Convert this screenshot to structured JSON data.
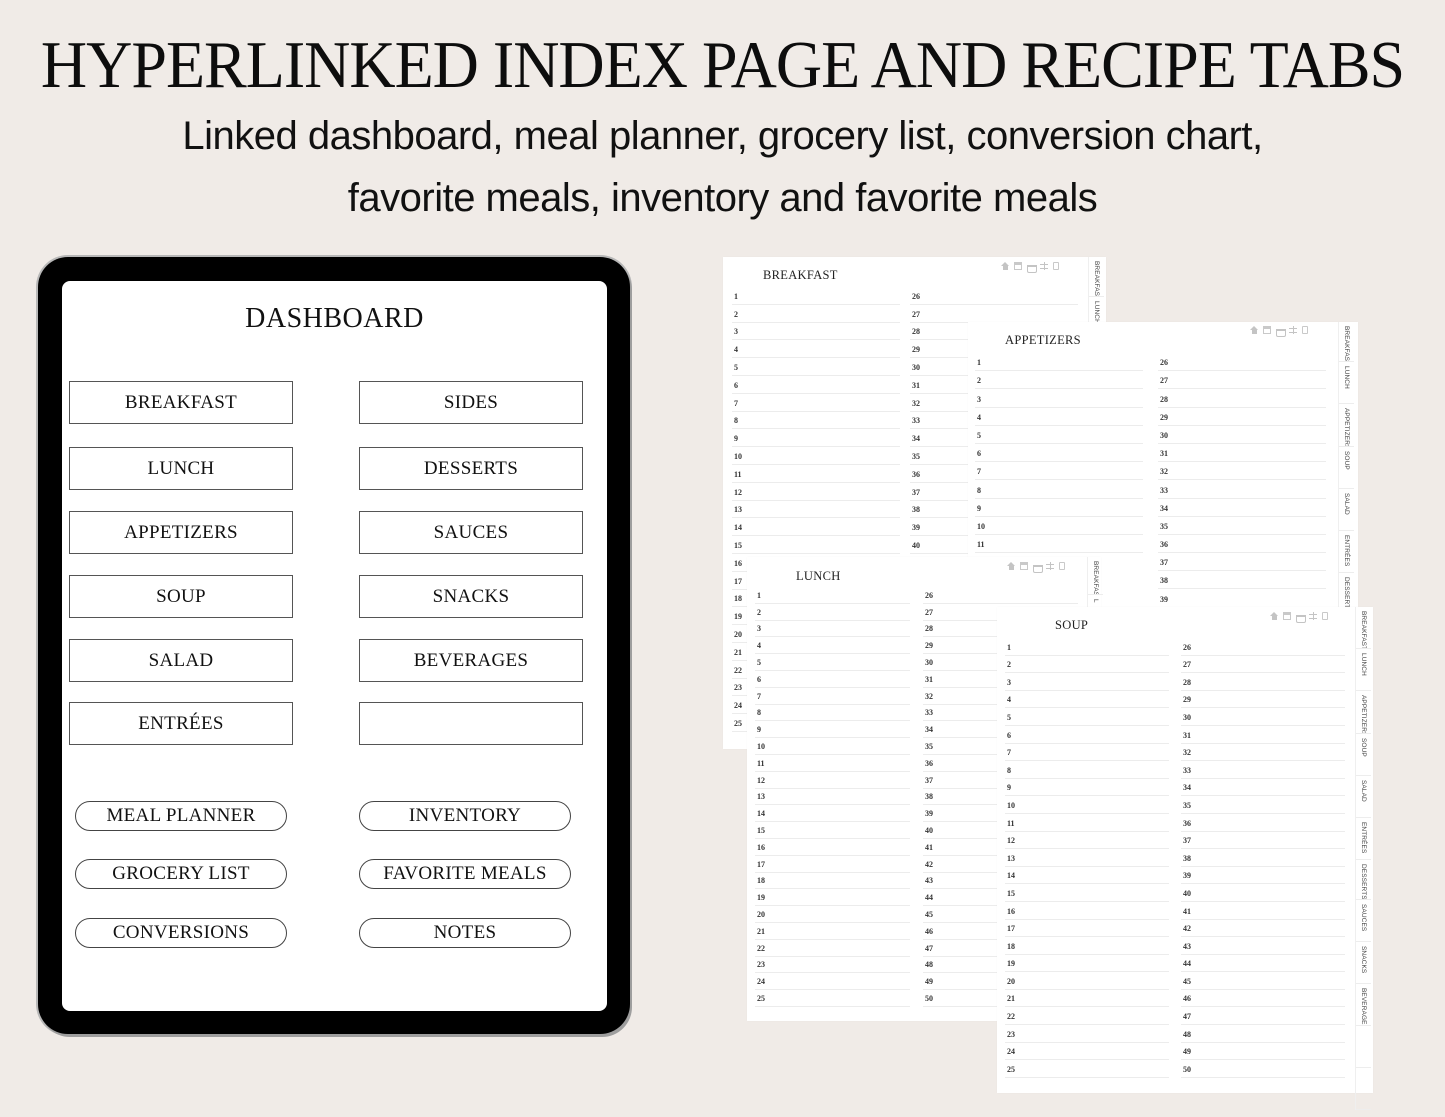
{
  "header": {
    "title": "HYPERLINKED INDEX PAGE AND RECIPE TABS",
    "subtitle_line1": "Linked dashboard, meal planner, grocery list, conversion chart,",
    "subtitle_line2": "favorite meals, inventory and favorite meals"
  },
  "dashboard": {
    "title": "DASHBOARD",
    "category_buttons": [
      {
        "label": "BREAKFAST"
      },
      {
        "label": "SIDES"
      },
      {
        "label": "LUNCH"
      },
      {
        "label": "DESSERTS"
      },
      {
        "label": "APPETIZERS"
      },
      {
        "label": "SAUCES"
      },
      {
        "label": "SOUP"
      },
      {
        "label": "SNACKS"
      },
      {
        "label": "SALAD"
      },
      {
        "label": "BEVERAGES"
      },
      {
        "label": "ENTRÉES"
      },
      {
        "label": ""
      }
    ],
    "link_buttons": [
      {
        "label": "MEAL PLANNER"
      },
      {
        "label": "INVENTORY"
      },
      {
        "label": "GROCERY LIST"
      },
      {
        "label": "FAVORITE MEALS"
      },
      {
        "label": "CONVERSIONS"
      },
      {
        "label": "NOTES"
      }
    ]
  },
  "recipe_pages": [
    {
      "title": "BREAKFAST",
      "left_start": 1,
      "left_count": 25,
      "right_start": 26,
      "right_count": 15,
      "tabs": [
        "BREAKFAST",
        "LUNCH"
      ]
    },
    {
      "title": "APPETIZERS",
      "left_start": 1,
      "left_count": 11,
      "right_start": 26,
      "right_count": 14,
      "tabs": [
        "BREAKFAST",
        "LUNCH",
        "APPETIZERS",
        "SOUP",
        "SALAD",
        "ENTRÉES",
        "DESSERTS"
      ]
    },
    {
      "title": "LUNCH",
      "left_start": 1,
      "left_count": 25,
      "right_start": 26,
      "right_count": 25,
      "tabs": [
        "BREAKFAST",
        "L"
      ]
    },
    {
      "title": "SOUP",
      "left_start": 1,
      "left_count": 25,
      "right_start": 26,
      "right_count": 25,
      "tabs": [
        "BREAKFAST",
        "LUNCH",
        "APPETIZERS",
        "SOUP",
        "SALAD",
        "ENTRÉES",
        "DESSERTS",
        "SAUCES",
        "SNACKS",
        "BEVERAGES",
        "",
        ""
      ]
    }
  ],
  "nav_icons": [
    "home-icon",
    "calendar-icon",
    "basket-icon",
    "scale-icon",
    "notes-icon"
  ]
}
